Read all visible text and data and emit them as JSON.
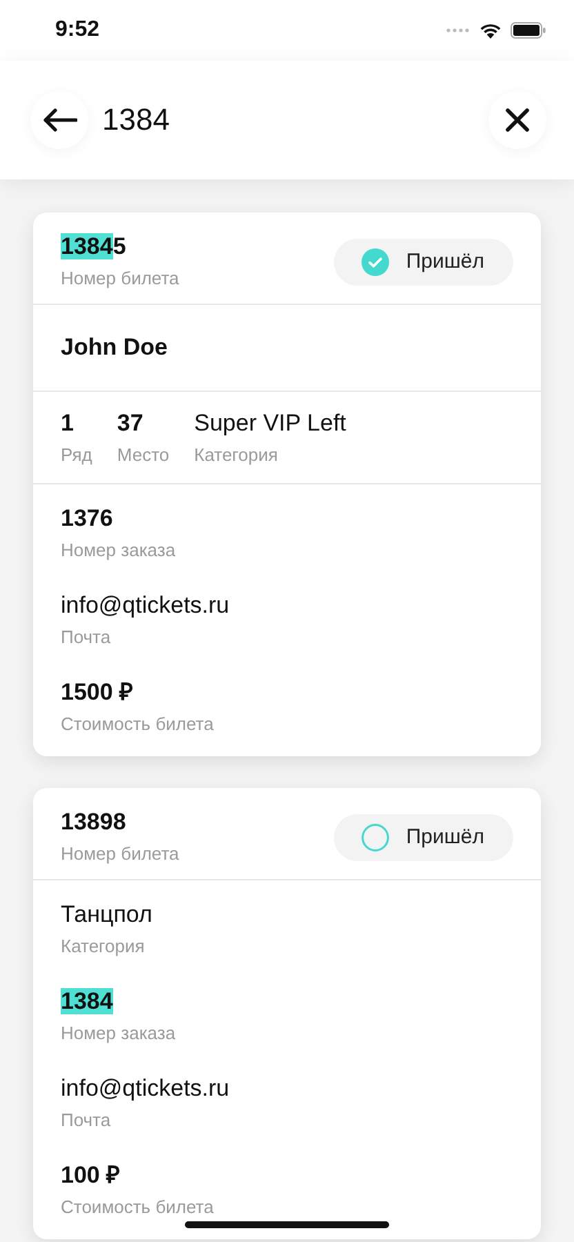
{
  "status_bar": {
    "time": "9:52"
  },
  "search": {
    "value": "1384"
  },
  "cards": [
    {
      "ticket": {
        "parts": [
          {
            "text": "1384",
            "highlighted": true
          },
          {
            "text": "5",
            "highlighted": false
          }
        ],
        "label": "Номер билета"
      },
      "arrived": {
        "label": "Пришёл",
        "checked": true
      },
      "sections": [
        {
          "kind": "column",
          "fields": [
            {
              "kind": "bold",
              "parts": [
                {
                  "text": "John Doe",
                  "highlighted": false
                }
              ]
            }
          ]
        },
        {
          "kind": "row",
          "fields": [
            {
              "kind": "bold",
              "parts": [
                {
                  "text": "1",
                  "highlighted": false
                }
              ],
              "label": "Ряд"
            },
            {
              "kind": "bold",
              "parts": [
                {
                  "text": "37",
                  "highlighted": false
                }
              ],
              "label": "Место"
            },
            {
              "kind": "plain",
              "parts": [
                {
                  "text": "Super VIP Left",
                  "highlighted": false
                }
              ],
              "label": "Категория"
            }
          ]
        },
        {
          "kind": "column",
          "fields": [
            {
              "kind": "bold",
              "parts": [
                {
                  "text": "1376",
                  "highlighted": false
                }
              ],
              "label": "Номер заказа"
            },
            {
              "kind": "plain",
              "parts": [
                {
                  "text": "info@qtickets.ru",
                  "highlighted": false
                }
              ],
              "label": "Почта"
            },
            {
              "kind": "bold",
              "parts": [
                {
                  "text": "1500 ₽",
                  "highlighted": false
                }
              ],
              "label": "Стоимость билета"
            }
          ]
        }
      ]
    },
    {
      "ticket": {
        "parts": [
          {
            "text": "13898",
            "highlighted": false
          }
        ],
        "label": "Номер билета"
      },
      "arrived": {
        "label": "Пришёл",
        "checked": false
      },
      "sections": [
        {
          "kind": "column",
          "fields": [
            {
              "kind": "plain",
              "parts": [
                {
                  "text": "Танцпол",
                  "highlighted": false
                }
              ],
              "label": "Категория"
            },
            {
              "kind": "bold",
              "parts": [
                {
                  "text": "1384",
                  "highlighted": true
                }
              ],
              "label": "Номер заказа"
            },
            {
              "kind": "plain",
              "parts": [
                {
                  "text": "info@qtickets.ru",
                  "highlighted": false
                }
              ],
              "label": "Почта"
            },
            {
              "kind": "bold",
              "parts": [
                {
                  "text": "100 ₽",
                  "highlighted": false
                }
              ],
              "label": "Стоимость билета"
            }
          ]
        }
      ]
    }
  ]
}
